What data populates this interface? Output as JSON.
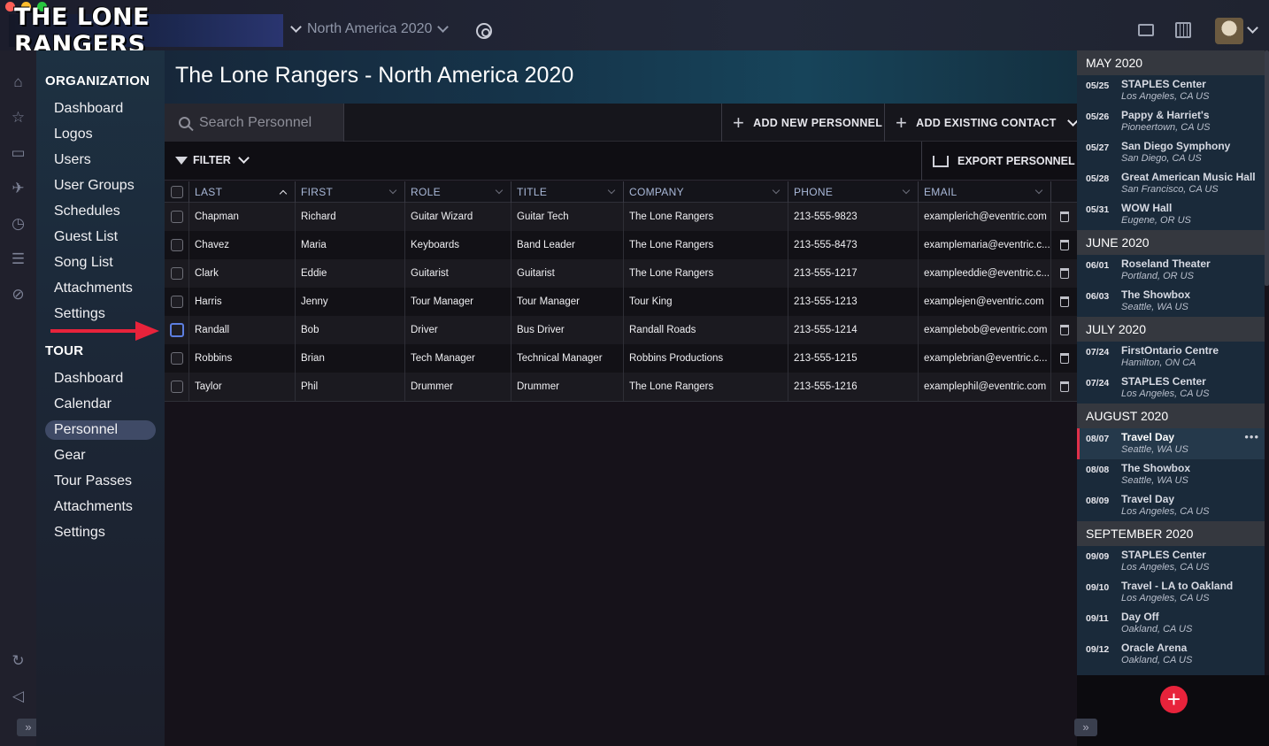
{
  "app": {
    "logo_text": "THE LONE RANGERS",
    "tour_select": "North America 2020",
    "page_title": "The Lone Rangers - North America 2020"
  },
  "colors": {
    "accent_red": "#e8233b",
    "active_nav": "#3f4a66",
    "header_text": "#a9b8d8"
  },
  "icons": {
    "rail": [
      "home-icon",
      "star-icon",
      "briefcase-icon",
      "plane-icon",
      "clock-icon",
      "list-icon",
      "paperclip-icon",
      "refresh-icon",
      "megaphone-icon"
    ],
    "top": [
      "gear-icon",
      "id-card-icon",
      "calendar-icon",
      "avatar"
    ]
  },
  "nav": {
    "org_heading": "ORGANIZATION",
    "org_items": [
      "Dashboard",
      "Logos",
      "Users",
      "User Groups",
      "Schedules",
      "Guest List",
      "Song List",
      "Attachments",
      "Settings"
    ],
    "tour_heading": "TOUR",
    "tour_items": [
      "Dashboard",
      "Calendar",
      "Personnel",
      "Gear",
      "Tour Passes",
      "Attachments",
      "Settings"
    ],
    "active": "Personnel"
  },
  "toolbar": {
    "search_placeholder": "Search Personnel",
    "add_new": "ADD NEW PERSONNEL",
    "add_existing": "ADD EXISTING CONTACT",
    "filter": "FILTER",
    "export": "EXPORT PERSONNEL"
  },
  "table": {
    "columns": [
      "LAST",
      "FIRST",
      "ROLE",
      "TITLE",
      "COMPANY",
      "PHONE",
      "EMAIL"
    ],
    "rows": [
      [
        "Chapman",
        "Richard",
        "Guitar Wizard",
        "Guitar Tech",
        "The Lone Rangers",
        "213-555-9823",
        "examplerich@eventric.com"
      ],
      [
        "Chavez",
        "Maria",
        "Keyboards",
        "Band Leader",
        "The Lone Rangers",
        "213-555-8473",
        "examplemaria@eventric.c..."
      ],
      [
        "Clark",
        "Eddie",
        "Guitarist",
        "Guitarist",
        "The Lone Rangers",
        "213-555-1217",
        "exampleeddie@eventric.c..."
      ],
      [
        "Harris",
        "Jenny",
        "Tour Manager",
        "Tour Manager",
        "Tour King",
        "213-555-1213",
        "examplejen@eventric.com"
      ],
      [
        "Randall",
        "Bob",
        "Driver",
        "Bus Driver",
        "Randall Roads",
        "213-555-1214",
        "examplebob@eventric.com"
      ],
      [
        "Robbins",
        "Brian",
        "Tech Manager",
        "Technical Manager",
        "Robbins Productions",
        "213-555-1215",
        "examplebrian@eventric.c..."
      ],
      [
        "Taylor",
        "Phil",
        "Drummer",
        "Drummer",
        "The Lone Rangers",
        "213-555-1216",
        "examplephil@eventric.com"
      ]
    ],
    "focused_row": 4
  },
  "schedule": [
    {
      "month": "MAY 2020",
      "events": [
        {
          "date": "05/25",
          "name": "STAPLES Center",
          "loc": "Los Angeles, CA US"
        },
        {
          "date": "05/26",
          "name": "Pappy & Harriet's",
          "loc": "Pioneertown, CA US"
        },
        {
          "date": "05/27",
          "name": "San Diego Symphony",
          "loc": "San Diego, CA US"
        },
        {
          "date": "05/28",
          "name": "Great American Music Hall",
          "loc": "San Francisco, CA US"
        },
        {
          "date": "05/31",
          "name": "WOW Hall",
          "loc": "Eugene, OR US"
        }
      ]
    },
    {
      "month": "JUNE 2020",
      "events": [
        {
          "date": "06/01",
          "name": "Roseland Theater",
          "loc": "Portland, OR US"
        },
        {
          "date": "06/03",
          "name": "The Showbox",
          "loc": "Seattle, WA US"
        }
      ]
    },
    {
      "month": "JULY 2020",
      "events": [
        {
          "date": "07/24",
          "name": "FirstOntario Centre",
          "loc": "Hamilton, ON CA"
        },
        {
          "date": "07/24",
          "name": "STAPLES Center",
          "loc": "Los Angeles, CA US"
        }
      ]
    },
    {
      "month": "AUGUST 2020",
      "events": [
        {
          "date": "08/07",
          "name": "Travel Day",
          "loc": "Seattle, WA US",
          "selected": true
        },
        {
          "date": "08/08",
          "name": "The Showbox",
          "loc": "Seattle, WA US"
        },
        {
          "date": "08/09",
          "name": "Travel Day",
          "loc": "Los Angeles, CA US"
        }
      ]
    },
    {
      "month": "SEPTEMBER 2020",
      "events": [
        {
          "date": "09/09",
          "name": "STAPLES Center",
          "loc": "Los Angeles, CA US"
        },
        {
          "date": "09/10",
          "name": "Travel - LA to Oakland",
          "loc": "Los Angeles, CA US"
        },
        {
          "date": "09/11",
          "name": "Day Off",
          "loc": "Oakland, CA US"
        },
        {
          "date": "09/12",
          "name": "Oracle Arena",
          "loc": "Oakland, CA US"
        }
      ]
    }
  ]
}
